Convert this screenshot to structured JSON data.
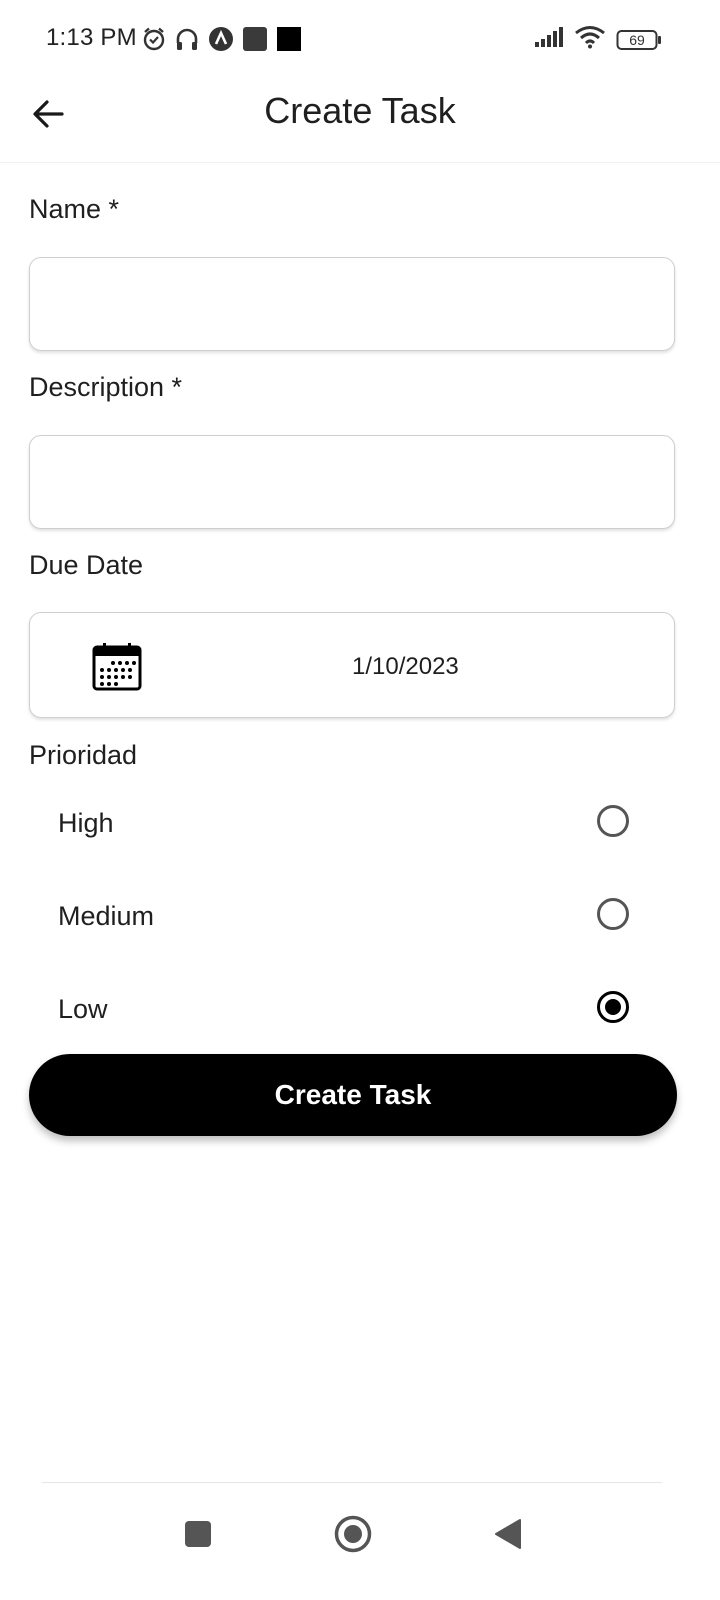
{
  "status_bar": {
    "time": "1:13 PM",
    "battery": "69",
    "icons_left": [
      "alarm-icon",
      "headphones-icon",
      "app-notification-icon",
      "square-notification-icon",
      "black-square-notification-icon"
    ],
    "icons_right": [
      "signal-icon",
      "wifi-icon",
      "battery-icon"
    ]
  },
  "header": {
    "title": "Create Task",
    "back_icon": "arrow-left-icon"
  },
  "form": {
    "name_label": "Name *",
    "name_value": "",
    "description_label": "Description *",
    "description_value": "",
    "due_date_label": "Due Date",
    "due_date_value": "1/10/2023",
    "due_date_icon": "calendar-icon",
    "priority_label": "Prioridad",
    "priority_options": [
      {
        "label": "High",
        "selected": false
      },
      {
        "label": "Medium",
        "selected": false
      },
      {
        "label": "Low",
        "selected": true
      }
    ],
    "submit_label": "Create Task"
  },
  "nav_bar": {
    "buttons": [
      "recent-apps-icon",
      "home-icon",
      "back-triangle-icon"
    ]
  },
  "colors": {
    "primary": "#000000",
    "background": "#ffffff",
    "text": "#1f1f1f",
    "input_border": "#cfcfcf"
  }
}
